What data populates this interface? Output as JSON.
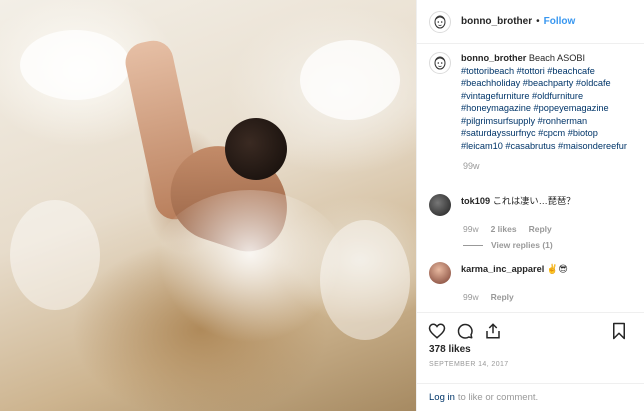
{
  "post": {
    "username": "bonno_brother",
    "dot": "•",
    "follow_label": "Follow",
    "caption_text": "Beach ASOBI",
    "hashtags": "#tottoribeach #tottori #beachcafe #beachholiday #beachparty #oldcafe #vintagefurniture #oldfurniture #honeymagazine #popeyemagazine #pilgrimsurfsupply #ronherman #saturdayssurfnyc #cpcm #biotop #leicam10 #casabrutus #maisondereefur",
    "caption_time": "99w",
    "likes": "378 likes",
    "date": "SEPTEMBER 14, 2017"
  },
  "comments": [
    {
      "username": "tok109",
      "text": "これは凄い…琵琶？",
      "time": "99w",
      "likes": "2 likes",
      "reply": "Reply",
      "view_replies": "View replies (1)",
      "avatar_color": "#2b2b2b"
    },
    {
      "username": "karma_inc_apparel",
      "text": "✌️😎",
      "time": "99w",
      "reply": "Reply",
      "avatar_color": "#a86b5a"
    }
  ],
  "footer": {
    "login_label": "Log in",
    "rest": "to like or comment."
  },
  "icons": {
    "like": "heart-icon",
    "comment": "comment-icon",
    "share": "share-icon",
    "save": "bookmark-icon"
  },
  "colors": {
    "link": "#003569",
    "follow": "#3897f0",
    "muted": "#999999"
  }
}
